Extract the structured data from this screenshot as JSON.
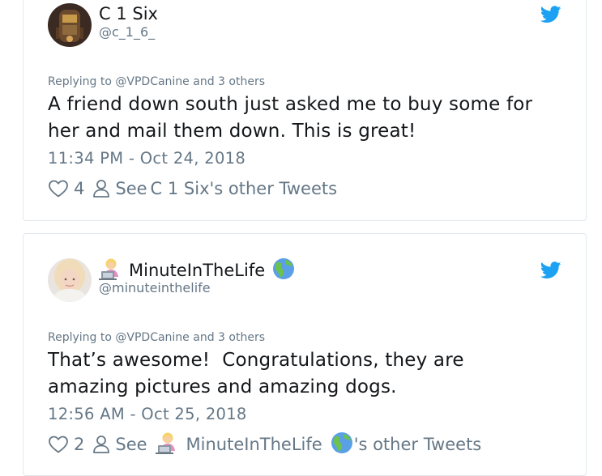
{
  "tweets": [
    {
      "display_name": "C 1 Six",
      "handle": "@c_1_6_",
      "replying_prefix": "Replying to",
      "replying_handle": "@VPDCanine",
      "replying_suffix": "and 3 others",
      "text": "A friend down south just asked me to buy some for her and mail them down. This is great!",
      "timestamp": "11:34 PM - Oct 24, 2018",
      "likes": "4",
      "see_prefix": "See",
      "see_name": "C 1 Six's other Tweets"
    },
    {
      "display_name": "MinuteInTheLife",
      "handle": "@minuteinthelife",
      "replying_prefix": "Replying to",
      "replying_handle": "@VPDCanine",
      "replying_suffix": "and 3 others",
      "text": "That’s awesome!  Congratulations, they are amazing pictures and amazing dogs.",
      "timestamp": "12:56 AM - Oct 25, 2018",
      "likes": "2",
      "see_prefix": "See",
      "see_name": "MinuteInTheLife",
      "see_suffix": "'s other Tweets"
    }
  ],
  "colors": {
    "twitter_blue": "#1da1f2",
    "secondary_text": "#657786",
    "border": "#e1e8ed"
  }
}
